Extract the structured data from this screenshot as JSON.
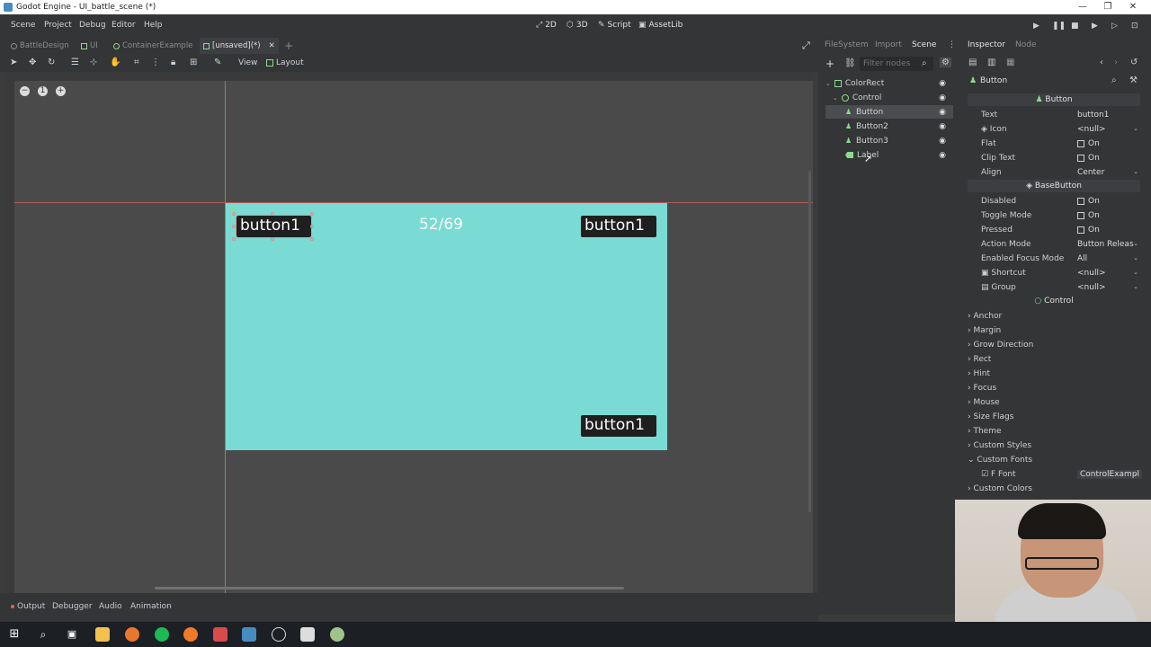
{
  "window": {
    "title": "Godot Engine - UI_battle_scene (*)"
  },
  "menu": [
    "Scene",
    "Project",
    "Debug",
    "Editor",
    "Help"
  ],
  "workspaces": {
    "2d": "2D",
    "3d": "3D",
    "script": "Script",
    "assetlib": "AssetLib"
  },
  "scene_tabs": [
    "BattleDesign",
    "UI",
    "ContainerExample",
    "[unsaved](*)"
  ],
  "toolbar": {
    "view": "View",
    "layout": "Layout"
  },
  "canvas": {
    "counter": "52/69",
    "button_top_left": "button1",
    "button_top_right": "button1",
    "button_bottom_right": "button1",
    "bg_color": "#79dbd4"
  },
  "bottom_tabs": [
    "Output",
    "Debugger",
    "Audio",
    "Animation"
  ],
  "dock_tabs": [
    "FileSystem",
    "Import",
    "Scene"
  ],
  "filter_placeholder": "Filter nodes",
  "tree": [
    {
      "name": "ColorRect"
    },
    {
      "name": "Control"
    },
    {
      "name": "Button"
    },
    {
      "name": "Button2"
    },
    {
      "name": "Button3"
    },
    {
      "name": "Label"
    }
  ],
  "inspector": {
    "tabs": [
      "Inspector",
      "Node"
    ],
    "node_path": "Button",
    "section_button": "Button",
    "section_basebutton": "BaseButton",
    "section_control": "Control",
    "props": {
      "text_k": "Text",
      "text_v": "button1",
      "icon_k": "Icon",
      "icon_v": "<null>",
      "flat_k": "Flat",
      "flat_v": "On",
      "clip_k": "Clip Text",
      "clip_v": "On",
      "align_k": "Align",
      "align_v": "Center",
      "disabled_k": "Disabled",
      "disabled_v": "On",
      "toggle_k": "Toggle Mode",
      "toggle_v": "On",
      "pressed_k": "Pressed",
      "pressed_v": "On",
      "action_k": "Action Mode",
      "action_v": "Button Releas",
      "focus_k": "Enabled Focus Mode",
      "focus_v": "All",
      "shortcut_k": "Shortcut",
      "shortcut_v": "<null>",
      "group_k": "Group",
      "group_v": "<null>",
      "font_k": "Font",
      "font_v": "ControlExampl"
    },
    "categories": [
      "Anchor",
      "Margin",
      "Grow Direction",
      "Rect",
      "Hint",
      "Focus",
      "Mouse",
      "Size Flags",
      "Theme",
      "Custom Styles",
      "Custom Fonts",
      "Custom Colors"
    ]
  }
}
